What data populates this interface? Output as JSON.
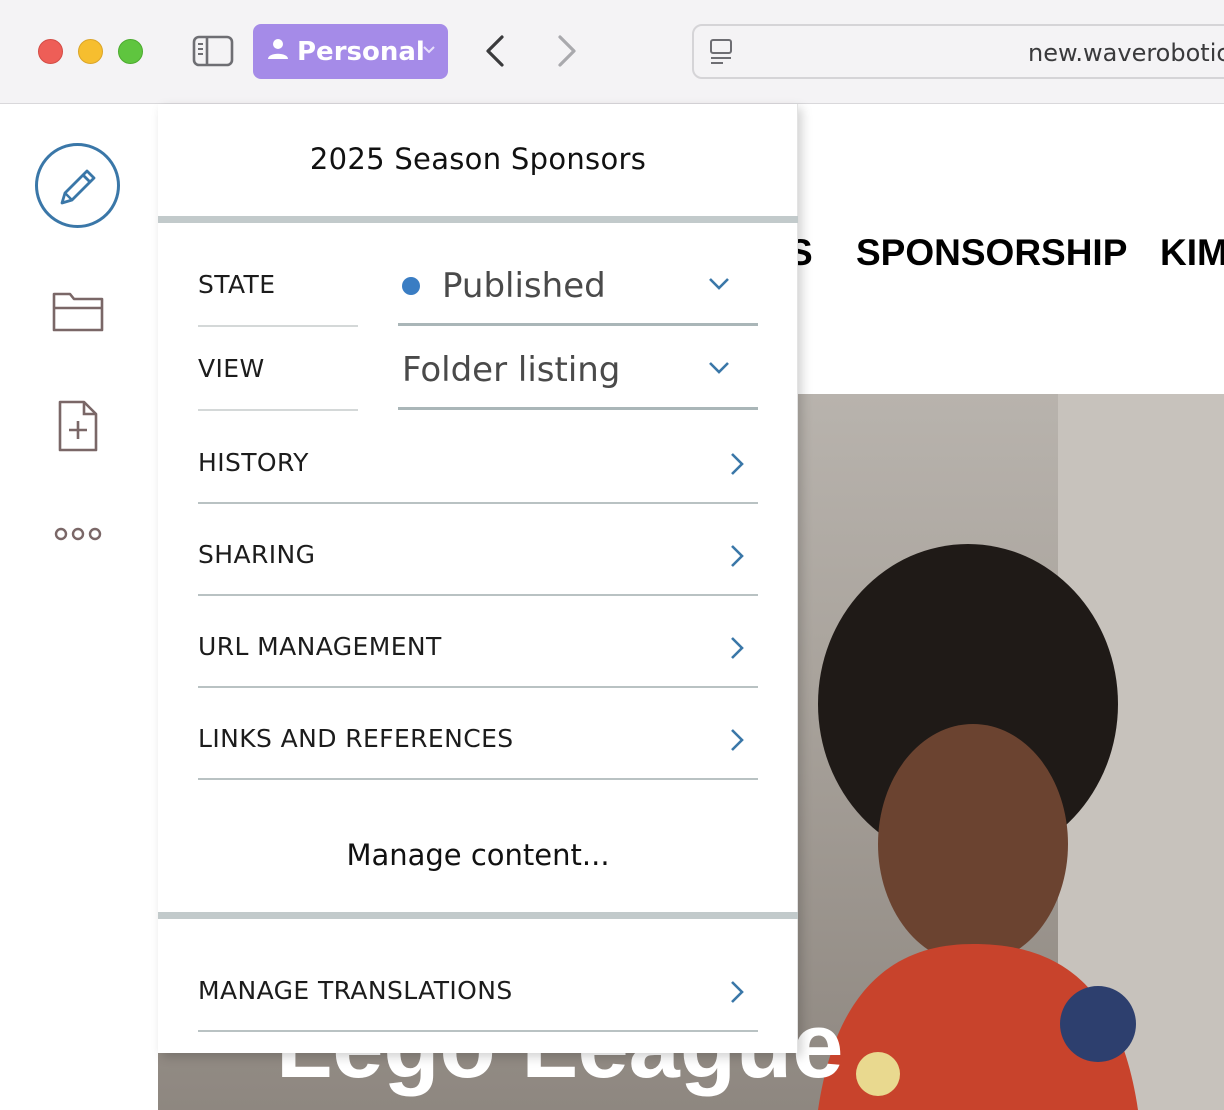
{
  "browser": {
    "profile_label": "Personal",
    "url": "new.waverobotic",
    "colors": {
      "profile_bg": "#a58be8",
      "chrome_bg": "#f4f3f5"
    },
    "icons": [
      "sidebar-icon",
      "person-icon",
      "chevron-down-icon",
      "back-icon",
      "forward-icon",
      "reader-icon"
    ]
  },
  "toolbar": {
    "icons": [
      "pencil-icon",
      "folder-icon",
      "add-document-icon",
      "more-icon"
    ],
    "accent": "#3a77a8"
  },
  "site": {
    "nav_items": [
      "S",
      "SPONSORSHIP",
      "KIM"
    ],
    "hero_title": "Lego League"
  },
  "panel": {
    "title": "2025 Season Sponsors",
    "state": {
      "label": "STATE",
      "value": "Published",
      "status_color": "#3a7dc3"
    },
    "view": {
      "label": "VIEW",
      "value": "Folder listing"
    },
    "nav_rows": [
      {
        "label": "HISTORY"
      },
      {
        "label": "SHARING"
      },
      {
        "label": "URL MANAGEMENT"
      },
      {
        "label": "LINKS AND REFERENCES"
      }
    ],
    "manage_content": "Manage content...",
    "manage_translations": "MANAGE TRANSLATIONS"
  }
}
